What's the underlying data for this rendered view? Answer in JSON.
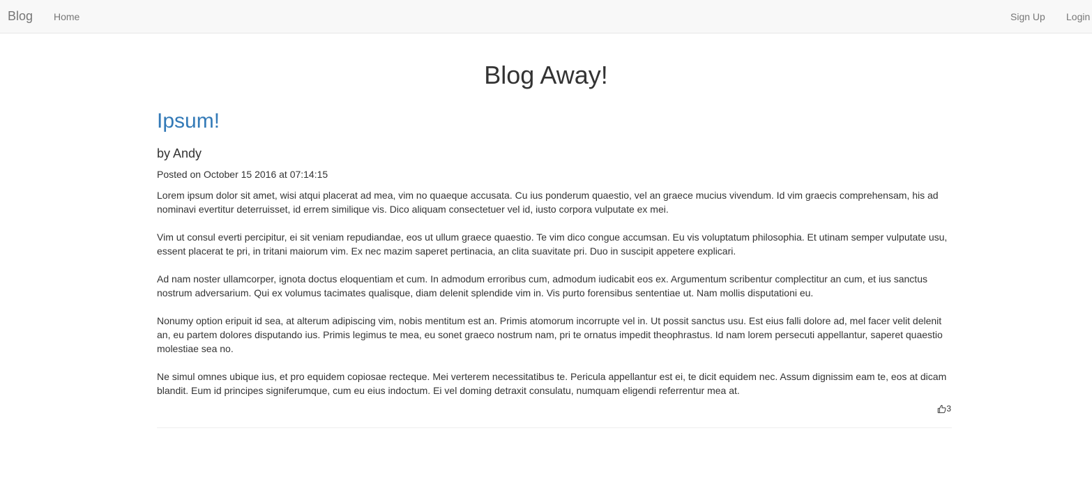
{
  "navbar": {
    "brand": "Blog",
    "home": "Home",
    "signup": "Sign Up",
    "login": "Login"
  },
  "page": {
    "title": "Blog Away!"
  },
  "post": {
    "title": "Ipsum!",
    "author": "by Andy",
    "posted": "Posted on October 15 2016 at 07:14:15",
    "paragraphs": [
      "Lorem ipsum dolor sit amet, wisi atqui placerat ad mea, vim no quaeque accusata. Cu ius ponderum quaestio, vel an graece mucius vivendum. Id vim graecis comprehensam, his ad nominavi evertitur deterruisset, id errem similique vis. Dico aliquam consectetuer vel id, iusto corpora vulputate ex mei.",
      "Vim ut consul everti percipitur, ei sit veniam repudiandae, eos ut ullum graece quaestio. Te vim dico congue accumsan. Eu vis voluptatum philosophia. Et utinam semper vulputate usu, essent placerat te pri, in tritani maiorum vim. Ex nec mazim saperet pertinacia, an clita suavitate pri. Duo in suscipit appetere explicari.",
      "Ad nam noster ullamcorper, ignota doctus eloquentiam et cum. In admodum erroribus cum, admodum iudicabit eos ex. Argumentum scribentur complectitur an cum, et ius sanctus nostrum adversarium. Qui ex volumus tacimates qualisque, diam delenit splendide vim in. Vis purto forensibus sententiae ut. Nam mollis disputationi eu.",
      "Nonumy option eripuit id sea, at alterum adipiscing vim, nobis mentitum est an. Primis atomorum incorrupte vel in. Ut possit sanctus usu. Est eius falli dolore ad, mel facer velit delenit an, eu partem dolores disputando ius. Primis legimus te mea, eu sonet graeco nostrum nam, pri te ornatus impedit theophrastus. Id nam lorem persecuti appellantur, saperet quaestio molestiae sea no.",
      "Ne simul omnes ubique ius, et pro equidem copiosae recteque. Mei verterem necessitatibus te. Pericula appellantur est ei, te dicit equidem nec. Assum dignissim eam te, eos at dicam blandit. Eum id principes signiferumque, cum eu eius indoctum. Ei vel doming detraxit consulatu, numquam eligendi referrentur mea at."
    ],
    "likes": "3",
    "like_icon": "thumbs-up-icon"
  },
  "colors": {
    "link": "#337ab7",
    "navbar_bg": "#f8f8f8",
    "nav_text": "#777777",
    "text": "#333333"
  }
}
